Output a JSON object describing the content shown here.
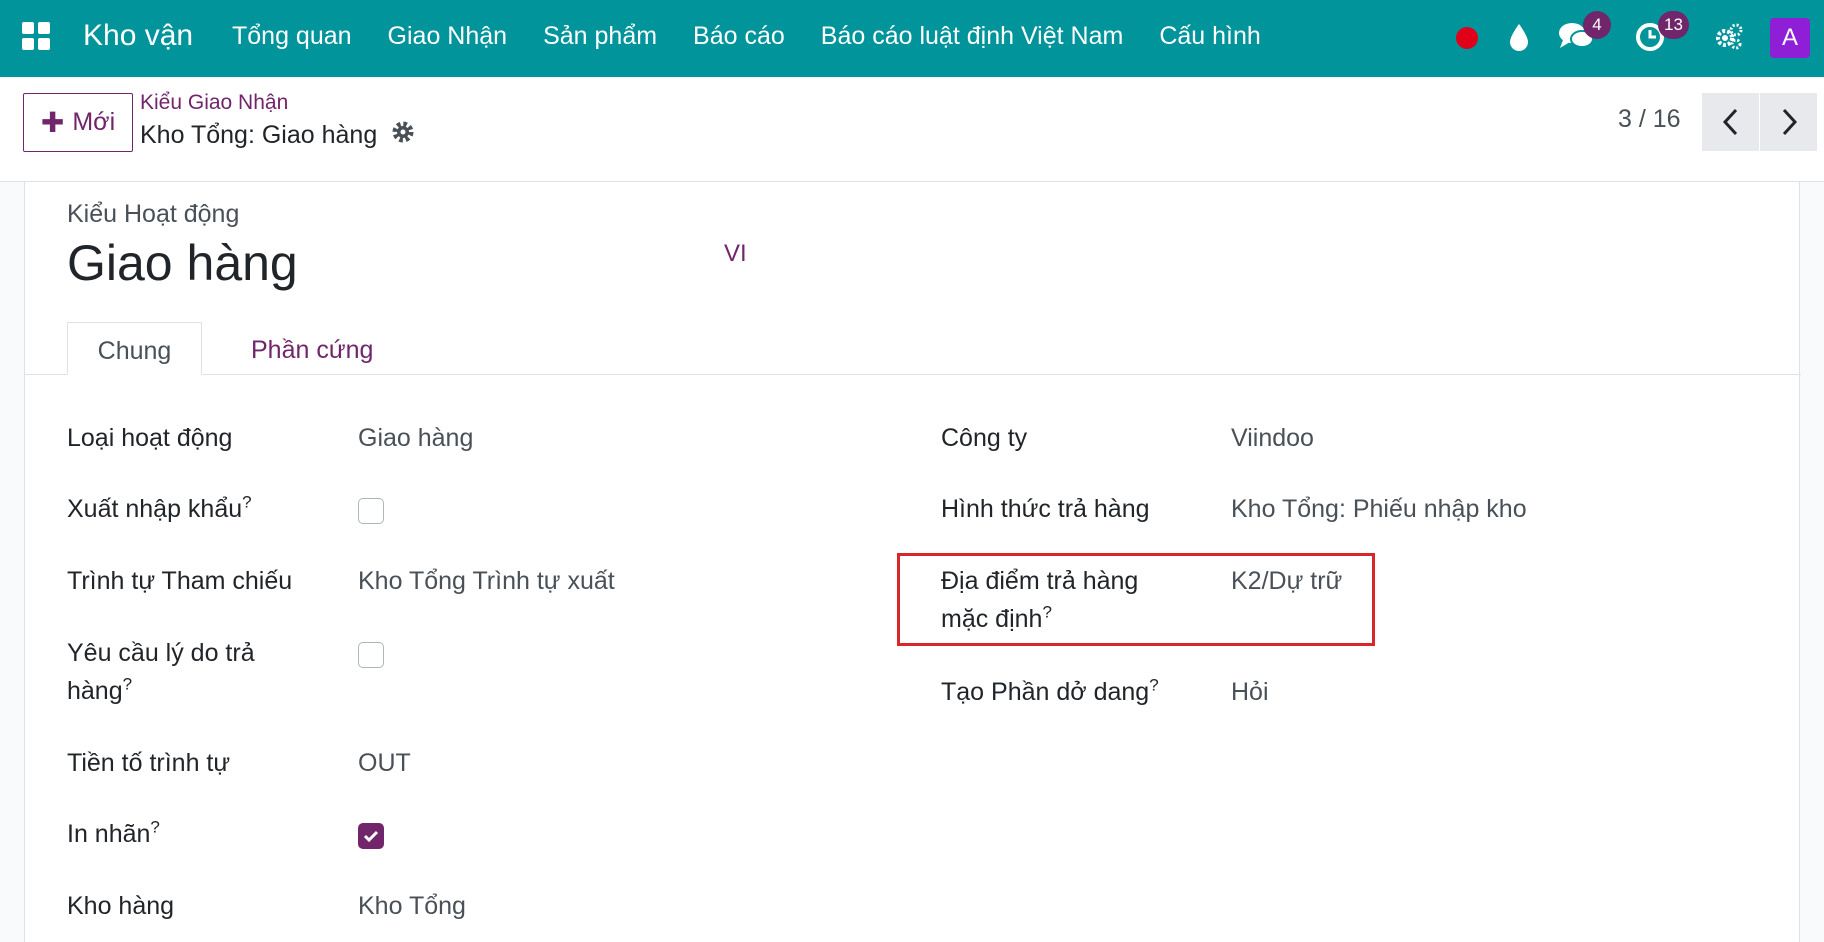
{
  "navbar": {
    "app_name": "Kho vận",
    "menu": [
      "Tổng quan",
      "Giao Nhận",
      "Sản phẩm",
      "Báo cáo",
      "Báo cáo luật định Việt Nam",
      "Cấu hình"
    ],
    "messages_count": "4",
    "activities_count": "13",
    "avatar_letter": "A"
  },
  "control_panel": {
    "new_button": "Mới",
    "breadcrumb": "Kiểu Giao Nhận",
    "record_name": "Kho Tổng: Giao hàng",
    "pager": "3 / 16"
  },
  "form": {
    "title_label": "Kiểu Hoạt động",
    "title": "Giao hàng",
    "lang": "VI",
    "tabs": [
      "Chung",
      "Phần cứng"
    ],
    "left_fields": {
      "operation_type": {
        "label": "Loại hoạt động",
        "value": "Giao hàng"
      },
      "import_export": {
        "label": "Xuất nhập khẩu",
        "help": "?",
        "checked": false
      },
      "reference_sequence": {
        "label": "Trình tự Tham chiếu",
        "value": "Kho Tổng Trình tự xuất"
      },
      "return_reason": {
        "label_line1": "Yêu cầu lý do trả",
        "label_line2": "hàng",
        "help": "?",
        "checked": false
      },
      "sequence_prefix": {
        "label": "Tiền tố trình tự",
        "value": "OUT"
      },
      "print_label": {
        "label": "In nhãn",
        "help": "?",
        "checked": true
      },
      "warehouse": {
        "label": "Kho hàng",
        "value": "Kho Tổng"
      }
    },
    "right_fields": {
      "company": {
        "label": "Công ty",
        "value": "Viindoo"
      },
      "return_type": {
        "label": "Hình thức trả hàng",
        "value": "Kho Tổng: Phiếu nhập kho"
      },
      "default_return_location": {
        "label_line1": "Địa điểm trả hàng",
        "label_line2": "mặc định",
        "help": "?",
        "value": "K2/Dự trữ"
      },
      "create_backorder": {
        "label": "Tạo Phần dở dang",
        "help": "?",
        "value": "Hỏi"
      }
    }
  },
  "colors": {
    "navbar": "#01949a",
    "accent": "#71256b",
    "highlight": "#d9262a"
  }
}
